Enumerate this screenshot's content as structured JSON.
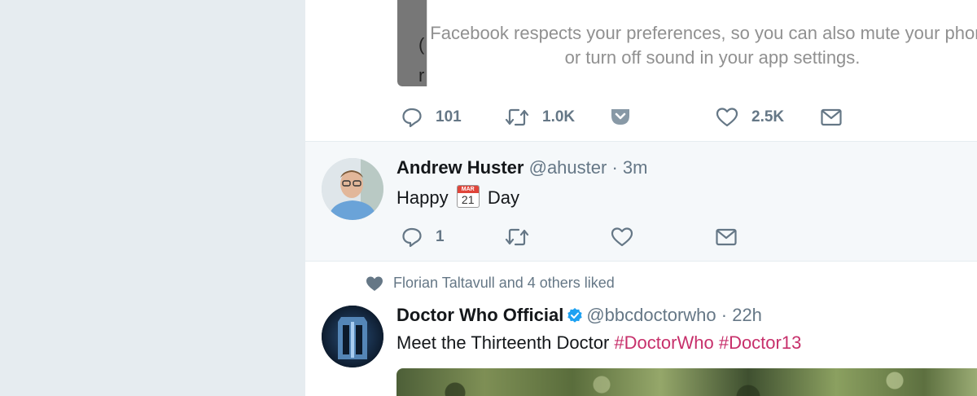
{
  "tweet1": {
    "sound_notice": "Facebook respects your preferences, so you can also mute your phone or turn off sound in your app settings.",
    "actions": {
      "reply_count": "101",
      "retweet_count": "1.0K",
      "like_count": "2.5K"
    },
    "icons": [
      "reply-icon",
      "retweet-icon",
      "pocket-icon",
      "heart-icon",
      "dm-icon"
    ]
  },
  "tweet2": {
    "name": "Andrew Huster",
    "handle": "@ahuster",
    "time": "· 3m",
    "text_before": "Happy",
    "calendar_month": "MAR",
    "calendar_day": "21",
    "text_after": "Day",
    "actions": {
      "reply_count": "1"
    }
  },
  "tweet3": {
    "liked_by": "Florian Taltavull and 4 others liked",
    "name": "Doctor Who Official",
    "handle": "@bbcdoctorwho",
    "time": "· 22h",
    "text": "Meet the Thirteenth Doctor",
    "hashtags": [
      "#DoctorWho",
      "#Doctor13"
    ]
  },
  "colors": {
    "background": "#e6ecf0",
    "text_primary": "#14171a",
    "text_secondary": "#657786",
    "hashtag": "#c7306b",
    "verified": "#1da1f2"
  }
}
